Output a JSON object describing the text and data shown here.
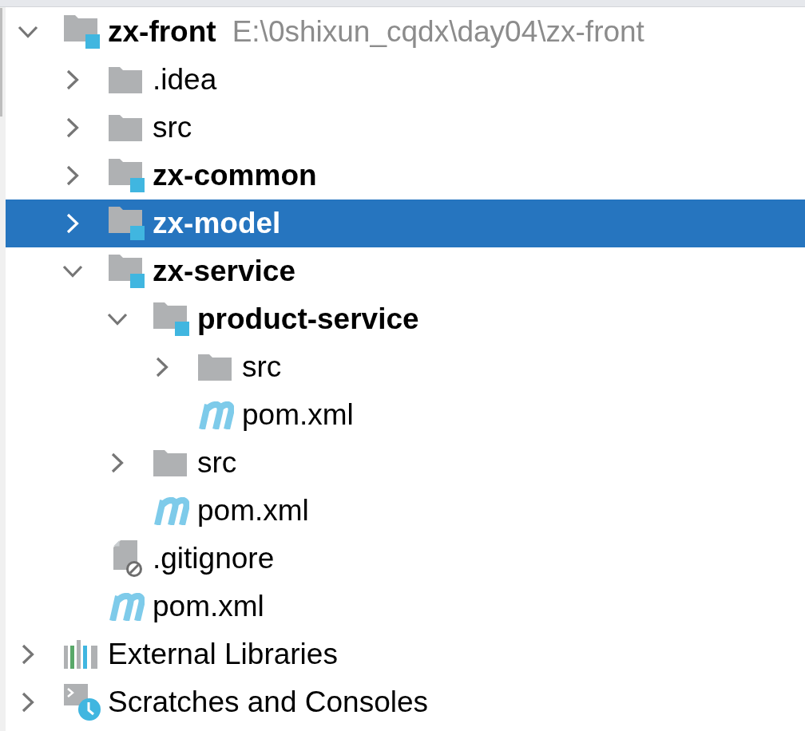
{
  "tree": {
    "items": [
      {
        "label": "zx-front",
        "path": "E:\\0shixun_cqdx\\day04\\zx-front",
        "kind": "module",
        "expanded": true,
        "selected": false,
        "children": [
          {
            "label": ".idea",
            "kind": "folder",
            "expanded": false,
            "selected": false
          },
          {
            "label": "src",
            "kind": "folder",
            "expanded": false,
            "selected": false
          },
          {
            "label": "zx-common",
            "kind": "module",
            "expanded": false,
            "selected": false
          },
          {
            "label": "zx-model",
            "kind": "module",
            "expanded": false,
            "selected": true
          },
          {
            "label": "zx-service",
            "kind": "module",
            "expanded": true,
            "selected": false,
            "children": [
              {
                "label": "product-service",
                "kind": "module",
                "expanded": true,
                "selected": false,
                "children": [
                  {
                    "label": "src",
                    "kind": "folder",
                    "expanded": false,
                    "selected": false
                  },
                  {
                    "label": "pom.xml",
                    "kind": "maven",
                    "selected": false
                  }
                ]
              },
              {
                "label": "src",
                "kind": "folder",
                "expanded": false,
                "selected": false
              },
              {
                "label": "pom.xml",
                "kind": "maven",
                "selected": false
              }
            ]
          },
          {
            "label": ".gitignore",
            "kind": "ignored",
            "selected": false
          },
          {
            "label": "pom.xml",
            "kind": "maven",
            "selected": false
          }
        ]
      },
      {
        "label": "External Libraries",
        "kind": "libraries",
        "expanded": false,
        "selected": false
      },
      {
        "label": "Scratches and Consoles",
        "kind": "scratches",
        "expanded": false,
        "selected": false
      }
    ]
  }
}
